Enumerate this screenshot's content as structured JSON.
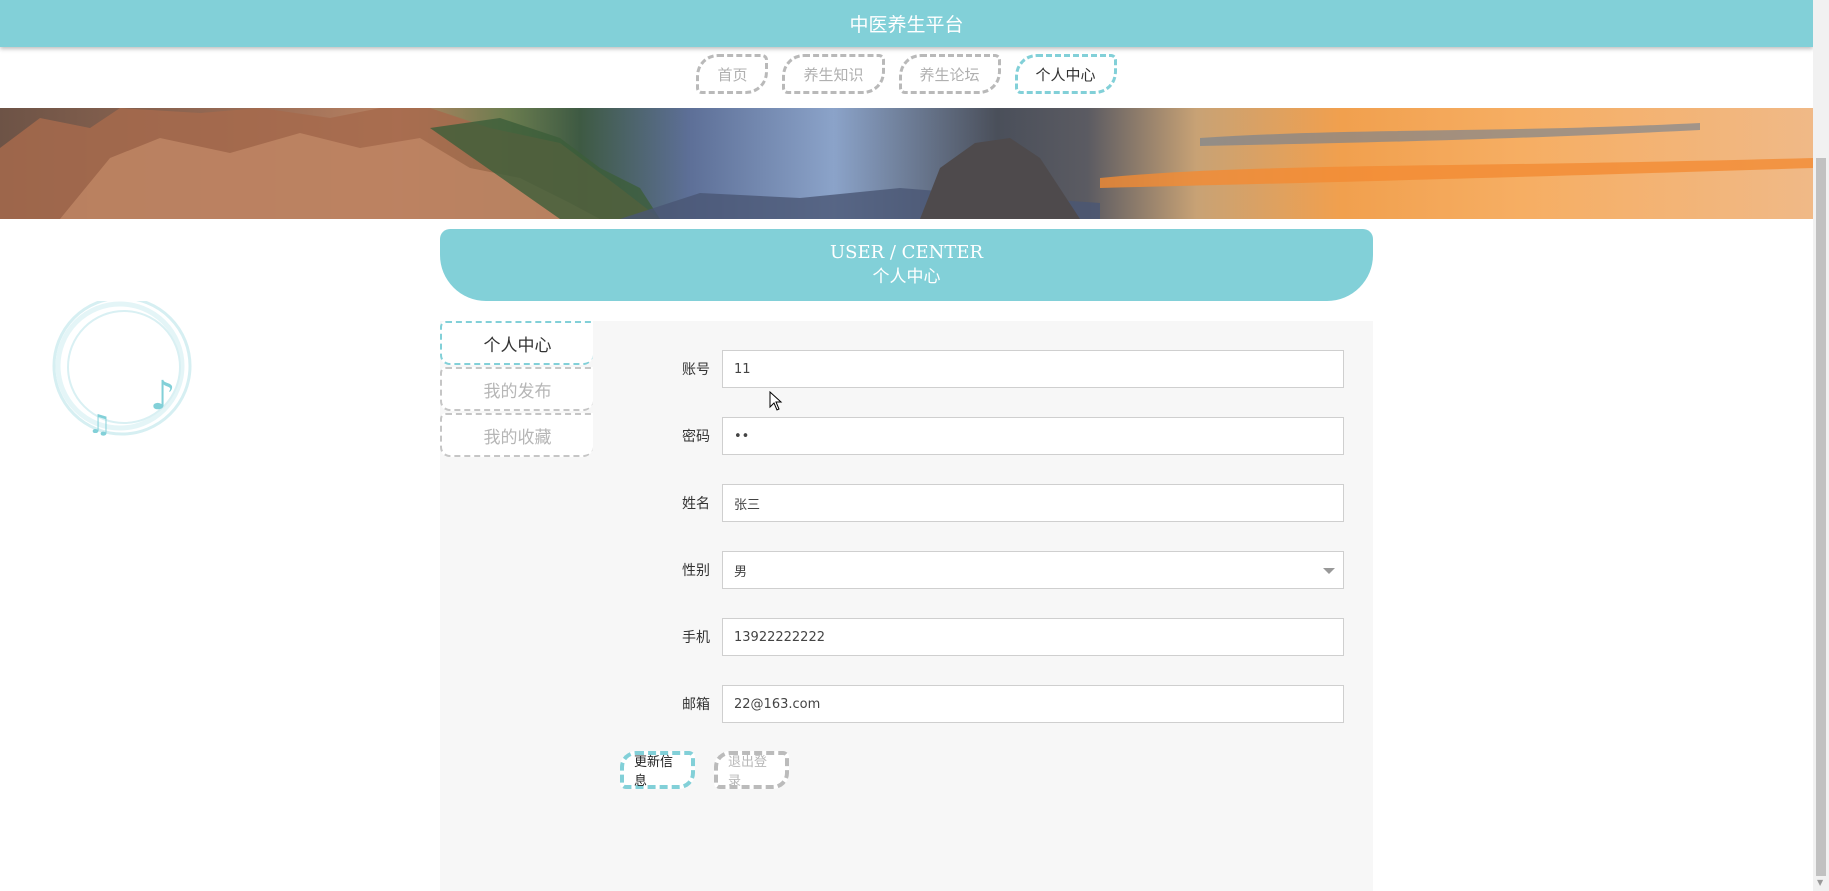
{
  "header": {
    "title": "中医养生平台",
    "brand_color": "#82d0d8"
  },
  "nav": {
    "tabs": [
      {
        "label": "首页",
        "active": false
      },
      {
        "label": "养生知识",
        "active": false
      },
      {
        "label": "养生论坛",
        "active": false
      },
      {
        "label": "个人中心",
        "active": true
      }
    ]
  },
  "user_center": {
    "title_en": "USER / CENTER",
    "title_cn": "个人中心"
  },
  "sidebar": {
    "items": [
      {
        "label": "个人中心",
        "active": true
      },
      {
        "label": "我的发布",
        "active": false
      },
      {
        "label": "我的收藏",
        "active": false
      }
    ]
  },
  "form": {
    "account": {
      "label": "账号",
      "value": "11"
    },
    "password": {
      "label": "密码",
      "value": "••"
    },
    "name": {
      "label": "姓名",
      "value": "张三"
    },
    "gender": {
      "label": "性别",
      "value": "男"
    },
    "phone": {
      "label": "手机",
      "value": "13922222222"
    },
    "email": {
      "label": "邮箱",
      "value": "22@163.com"
    }
  },
  "actions": {
    "update_label": "更新信息",
    "logout_label": "退出登录"
  },
  "icons": {
    "decor": "music-notes-icon",
    "cursor": "mouse-cursor-icon",
    "select_arrow": "chevron-down-icon"
  }
}
